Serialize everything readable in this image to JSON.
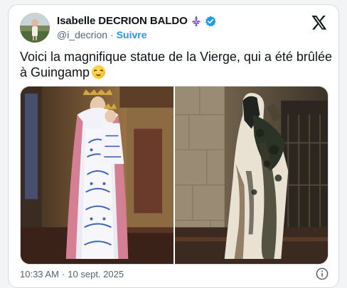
{
  "author": {
    "display_name": "Isabelle DECRION BALDO",
    "handle": "@i_decrion",
    "separator": "·",
    "follow_label": "Suivre"
  },
  "tweet": {
    "text": "Voici la magnifique statue de la Vierge, qui a été brûlée à Guingamp",
    "emoji": "face-with-steam-from-nose"
  },
  "meta": {
    "time": "10:33 AM",
    "separator": "·",
    "date": "10 sept. 2025"
  },
  "icons": {
    "fleur": "fleur-de-lis-icon",
    "verified": "verified-badge-icon",
    "logo": "x-logo-icon",
    "info": "info-icon"
  },
  "colors": {
    "accent": "#1d9bf0",
    "text": "#0f1419",
    "muted": "#536471",
    "fleur": "#7e57c2"
  }
}
